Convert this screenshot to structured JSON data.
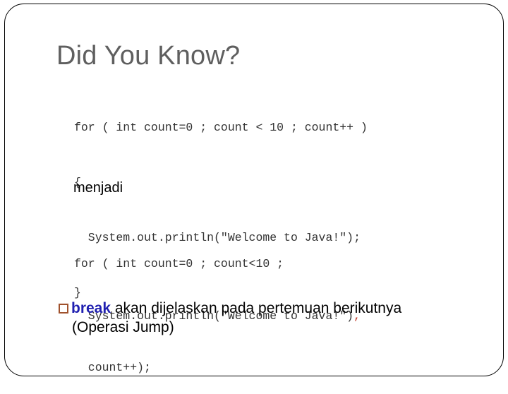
{
  "slide": {
    "title": "Did You Know?",
    "code_before": [
      "for ( int count=0 ; count < 10 ; count++ )",
      "{",
      "  System.out.println(\"Welcome to Java!\");",
      "}"
    ],
    "transition_word": "menjadi",
    "code_after": {
      "line1": "for ( int count=0 ; count<10 ;",
      "line2_main": "  System.out.println(\"Welcome to Java!\")",
      "line2_comma": ",",
      "line3": "  count++);"
    },
    "bullet": {
      "icon": "hollow-square-bullet",
      "keyword": "break",
      "text_line1": " akan dijelaskan pada pertemuan berikutnya",
      "text_line2": "(Operasi Jump)"
    },
    "colors": {
      "title": "#5f5f5f",
      "keyword": "#1f1fb0",
      "bullet": "#a0522d",
      "highlight_comma": "#c0392b"
    }
  }
}
